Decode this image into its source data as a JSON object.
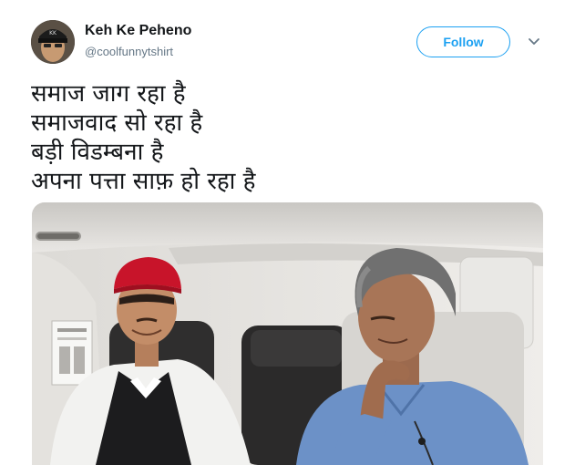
{
  "author": {
    "name": "Keh Ke Peheno",
    "handle": "@coolfunnytshirt",
    "avatar_icon": "profile-photo"
  },
  "actions": {
    "follow_label": "Follow",
    "menu_icon": "chevron-down-icon"
  },
  "tweet": {
    "lines": [
      "समाज जाग रहा है",
      "समाजवाद सो रहा है",
      "बड़ी विडम्बना है",
      "अपना पत्ता साफ़ हो रहा है"
    ]
  },
  "media": {
    "type": "photo",
    "subject": "two men seated in a helicopter cabin"
  },
  "colors": {
    "accent": "#1da1f2",
    "name_text": "#14171a",
    "handle_text": "#657786"
  }
}
